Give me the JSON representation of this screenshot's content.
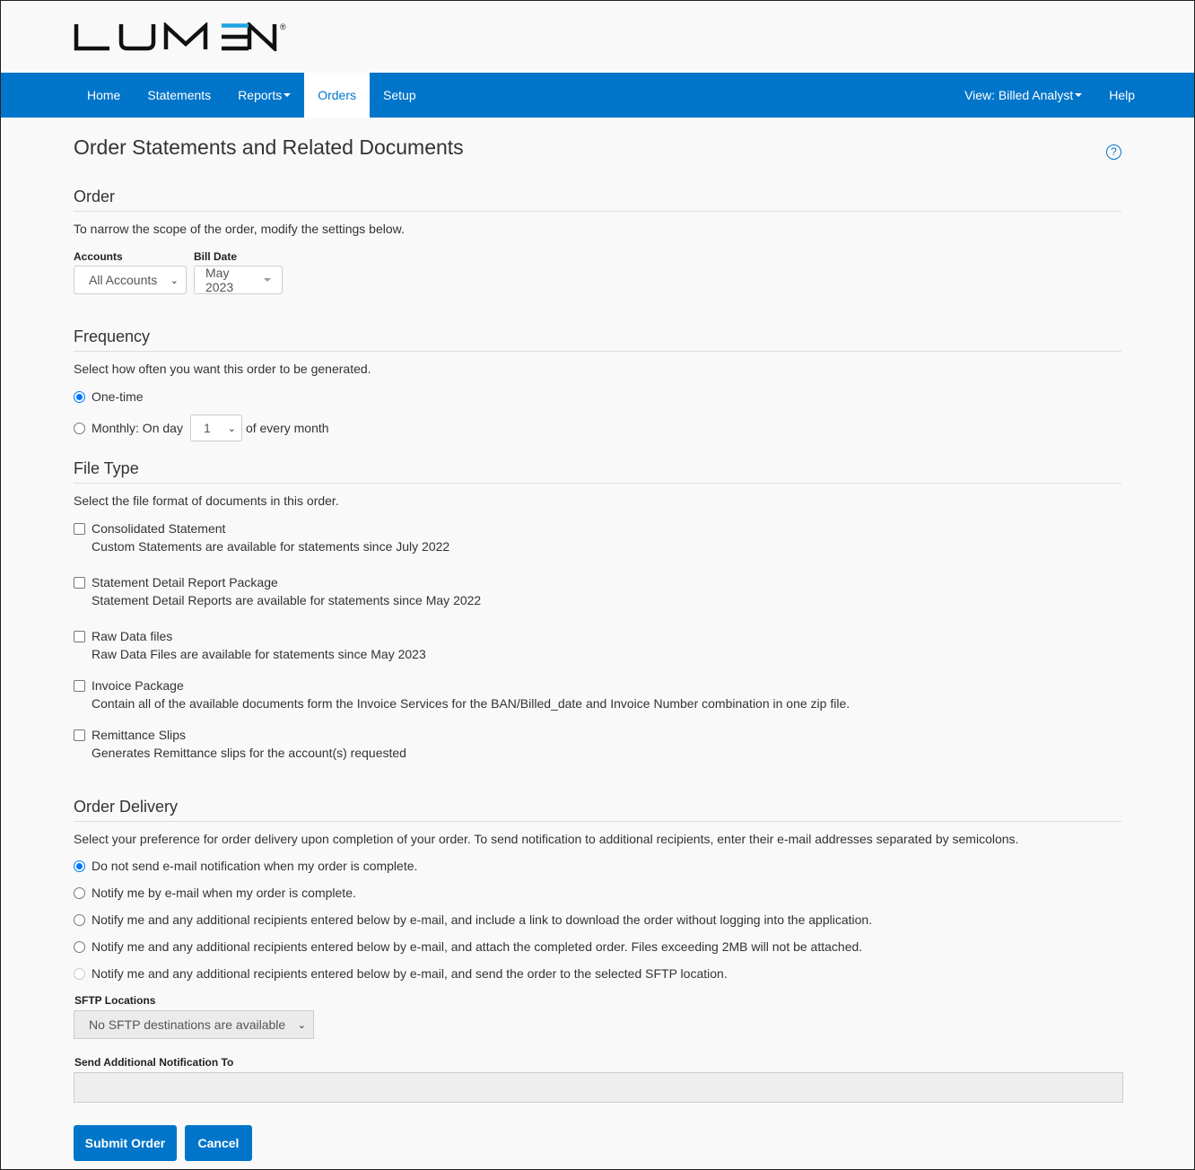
{
  "brand": {
    "name": "LUMEN",
    "reg_mark": "®",
    "accent": "#0075c9",
    "logo_bar_color": "#1fa3e0"
  },
  "nav": {
    "items": [
      {
        "label": "Home"
      },
      {
        "label": "Statements"
      },
      {
        "label": "Reports",
        "dropdown": true
      },
      {
        "label": "Orders",
        "active": true
      },
      {
        "label": "Setup"
      }
    ],
    "right": [
      {
        "label": "View: Billed Analyst",
        "dropdown": true
      },
      {
        "label": "Help"
      }
    ]
  },
  "page": {
    "title": "Order Statements and Related Documents",
    "help_icon": "?"
  },
  "order": {
    "heading": "Order",
    "description": "To narrow the scope of the order, modify the settings below.",
    "accounts_label": "Accounts",
    "accounts_value": "All Accounts",
    "bill_date_label": "Bill Date",
    "bill_date_value": "May 2023"
  },
  "frequency": {
    "heading": "Frequency",
    "description": "Select how often you want this order to be generated.",
    "one_time_label": "One-time",
    "one_time_checked": true,
    "monthly_label": "Monthly: On day",
    "monthly_day": "1",
    "monthly_suffix": "of every month"
  },
  "file_type": {
    "heading": "File Type",
    "description": "Select the file format of documents in this order.",
    "options": [
      {
        "label": "Consolidated Statement",
        "note": "Custom Statements are available for statements since July 2022",
        "checked": false
      },
      {
        "label": "Statement Detail Report Package",
        "note": "Statement Detail Reports are available for statements since May 2022",
        "checked": false
      },
      {
        "label": "Raw Data files",
        "note": "Raw Data Files are available for statements since May 2023",
        "checked": false
      },
      {
        "label": "Invoice Package",
        "note": "Contain all of the available documents form the Invoice Services for the BAN/Billed_date and Invoice Number combination in one zip file.",
        "checked": false
      },
      {
        "label": "Remittance Slips",
        "note": "Generates Remittance slips for the account(s) requested",
        "checked": false
      }
    ]
  },
  "delivery": {
    "heading": "Order Delivery",
    "description": "Select your preference for order delivery upon completion of your order. To send notification to additional recipients, enter their e-mail addresses separated by semicolons.",
    "options": [
      {
        "label": "Do not send e-mail notification when my order is complete.",
        "checked": true
      },
      {
        "label": "Notify me by e-mail when my order is complete.",
        "checked": false
      },
      {
        "label": "Notify me and any additional recipients entered below by e-mail, and include a link to download the order without logging into the application.",
        "checked": false
      },
      {
        "label": "Notify me and any additional recipients entered below by e-mail, and attach the completed order. Files exceeding 2MB will not be attached.",
        "checked": false
      },
      {
        "label": "Notify me and any additional recipients entered below by e-mail, and send the order to the selected SFTP location.",
        "checked": false,
        "disabled": true
      }
    ],
    "sftp_label": "SFTP Locations",
    "sftp_value": "No SFTP destinations are available",
    "additional_label": "Send Additional Notification To",
    "additional_value": ""
  },
  "actions": {
    "submit": "Submit Order",
    "cancel": "Cancel"
  }
}
